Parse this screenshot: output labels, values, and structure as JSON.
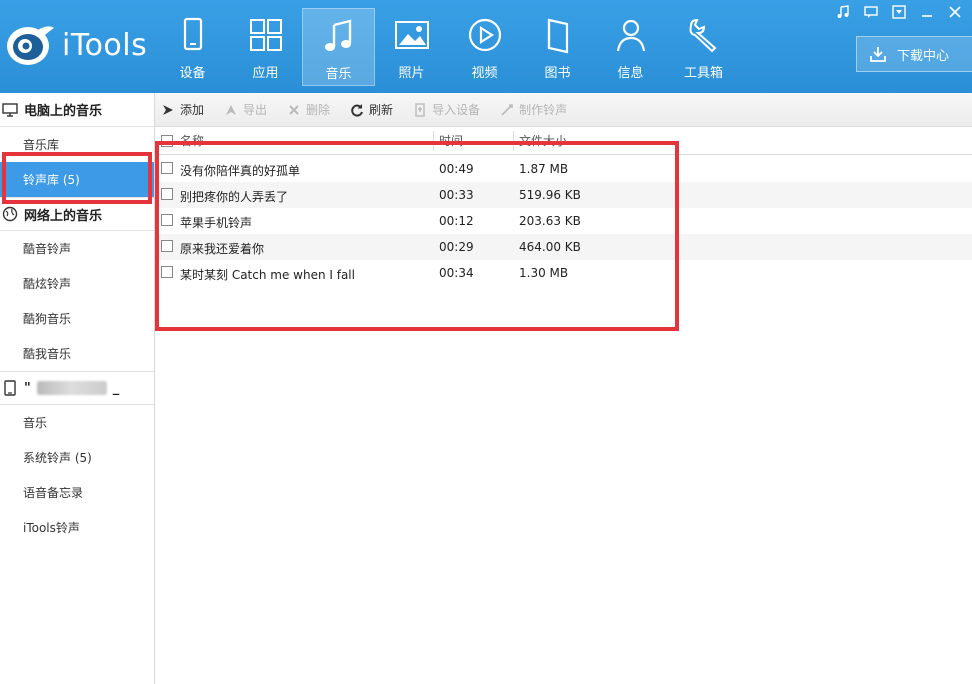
{
  "app": {
    "title": "iTools",
    "accent": "#2a8fd6",
    "highlight": "#e5343b"
  },
  "nav": [
    {
      "label": "设备",
      "icon": "phone-icon"
    },
    {
      "label": "应用",
      "icon": "apps-grid-icon"
    },
    {
      "label": "音乐",
      "icon": "music-note-icon",
      "active": true
    },
    {
      "label": "照片",
      "icon": "photo-icon"
    },
    {
      "label": "视频",
      "icon": "play-icon"
    },
    {
      "label": "图书",
      "icon": "book-icon"
    },
    {
      "label": "信息",
      "icon": "person-icon"
    },
    {
      "label": "工具箱",
      "icon": "wrench-icon"
    }
  ],
  "download_center": "下载中心",
  "sidebar": {
    "pc_section": "电脑上的音乐",
    "pc_items": [
      "音乐库",
      "铃声库 (5)"
    ],
    "web_section": "网络上的音乐",
    "web_items": [
      "酷音铃声",
      "酷炫铃声",
      "酷狗音乐",
      "酷我音乐"
    ],
    "device_prefix": "\"",
    "device_suffix": "_",
    "device_items": [
      "音乐",
      "系统铃声 (5)",
      "语音备忘录",
      "iTools铃声"
    ]
  },
  "toolbar": {
    "add": "添加",
    "export": "导出",
    "delete": "删除",
    "refresh": "刷新",
    "import_device": "导入设备",
    "make_ringtone": "制作铃声"
  },
  "table": {
    "columns": [
      "名称",
      "时间",
      "文件大小"
    ],
    "rows": [
      {
        "name": "没有你陪伴真的好孤单",
        "time": "00:49",
        "size": "1.87 MB"
      },
      {
        "name": "别把疼你的人弄丢了",
        "time": "00:33",
        "size": "519.96 KB"
      },
      {
        "name": "苹果手机铃声",
        "time": "00:12",
        "size": "203.63 KB"
      },
      {
        "name": "原来我还爱着你",
        "time": "00:29",
        "size": "464.00 KB"
      },
      {
        "name": "某时某刻 Catch me when I fall",
        "time": "00:34",
        "size": "1.30 MB"
      }
    ]
  }
}
